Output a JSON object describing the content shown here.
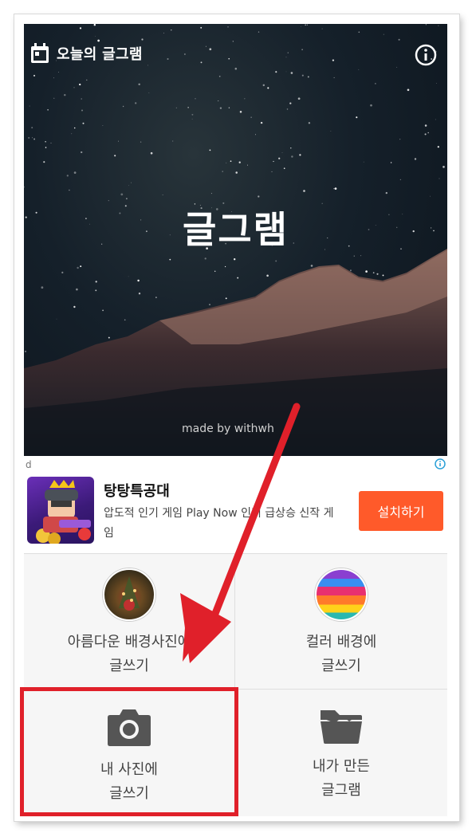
{
  "header": {
    "title": "오늘의 글그램",
    "calendar_icon": "calendar-icon",
    "info_icon": "info-icon"
  },
  "hero": {
    "title": "글그램",
    "credit": "made by withwh"
  },
  "ad": {
    "corner_mark": "d",
    "title": "탕탕특공대",
    "description": "압도적 인기 게임 Play Now 인기 급상승 신작 게임",
    "install_label": "설치하기",
    "install_color": "#ff5a2a",
    "info_icon": "adchoices-icon"
  },
  "menu": [
    {
      "id": "beautiful-bg",
      "label_line1": "아름다운 배경사진에",
      "label_line2": "글쓰기",
      "icon": "tree-photo-thumbnail"
    },
    {
      "id": "color-bg",
      "label_line1": "컬러 배경에",
      "label_line2": "글쓰기",
      "icon": "color-swatch-thumbnail"
    },
    {
      "id": "my-photo",
      "label_line1": "내 사진에",
      "label_line2": "글쓰기",
      "icon": "camera-icon"
    },
    {
      "id": "my-gallery",
      "label_line1": "내가 만든",
      "label_line2": "글그램",
      "icon": "folder-open-icon"
    }
  ],
  "annotation": {
    "highlight_color": "#e0202a",
    "arrow_color": "#e0202a"
  }
}
